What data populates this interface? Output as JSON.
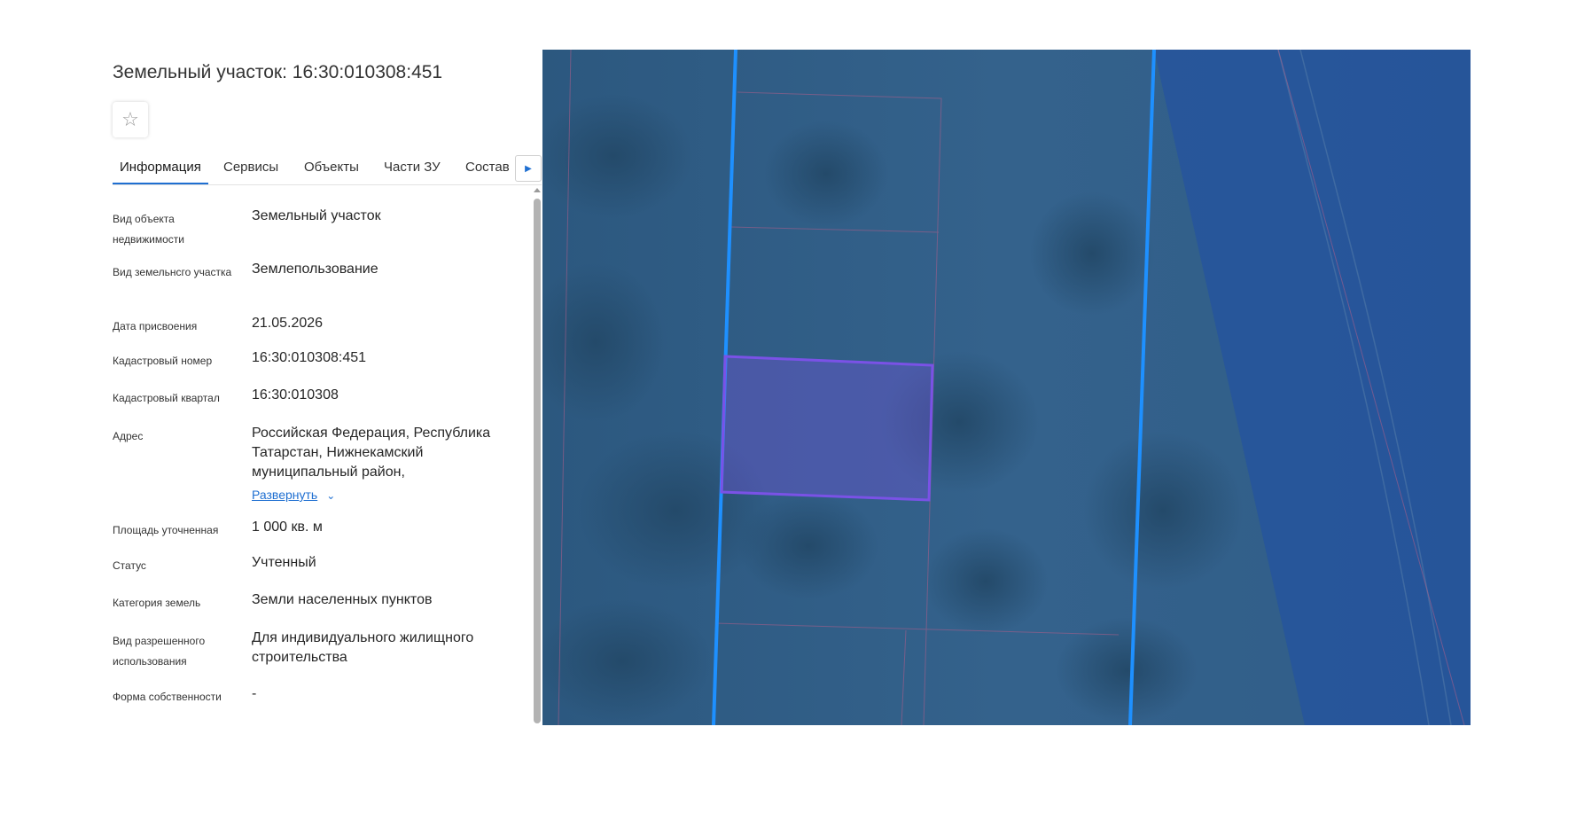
{
  "title": "Земельный участок: 16:30:010308:451",
  "favorite_icon": "star-outline-icon",
  "tabs": [
    {
      "label": "Информация",
      "active": true
    },
    {
      "label": "Сервисы",
      "active": false
    },
    {
      "label": "Объекты",
      "active": false
    },
    {
      "label": "Части ЗУ",
      "active": false
    },
    {
      "label": "Состав",
      "active": false
    }
  ],
  "tabs_next_icon": "caret-right-icon",
  "fields": [
    {
      "label": "Вид объекта недвижимости",
      "value": "Земельный участок"
    },
    {
      "label": "Вид земельнсго участка",
      "value": "Землепользование"
    },
    {
      "label": "Дата присвоения",
      "value": "21.05.2026"
    },
    {
      "label": "Кадастровый номер",
      "value": "16:30:010308:451"
    },
    {
      "label": "Кадастровый квартал",
      "value": "16:30:010308"
    },
    {
      "label": "Адрес",
      "value": "Российская Федерация, Республика Татарстан, Нижнекамский муниципальный район,",
      "expand_label": "Развернуть"
    },
    {
      "label": "Площадь уточненная",
      "value": "1 000 кв. м"
    },
    {
      "label": "Статус",
      "value": "Учтенный"
    },
    {
      "label": "Категория земель",
      "value": "Земли населенных пунктов"
    },
    {
      "label": "Вид разрешенного использования",
      "value": "Для индивидуального жилищного строительства"
    },
    {
      "label": "Форма собственности",
      "value": "-"
    }
  ],
  "colors": {
    "accent": "#1f6fd1",
    "boundary_line": "#1e90ff",
    "selected_parcel": "#7a52e6",
    "map_overlay": "#1f4fa8"
  }
}
